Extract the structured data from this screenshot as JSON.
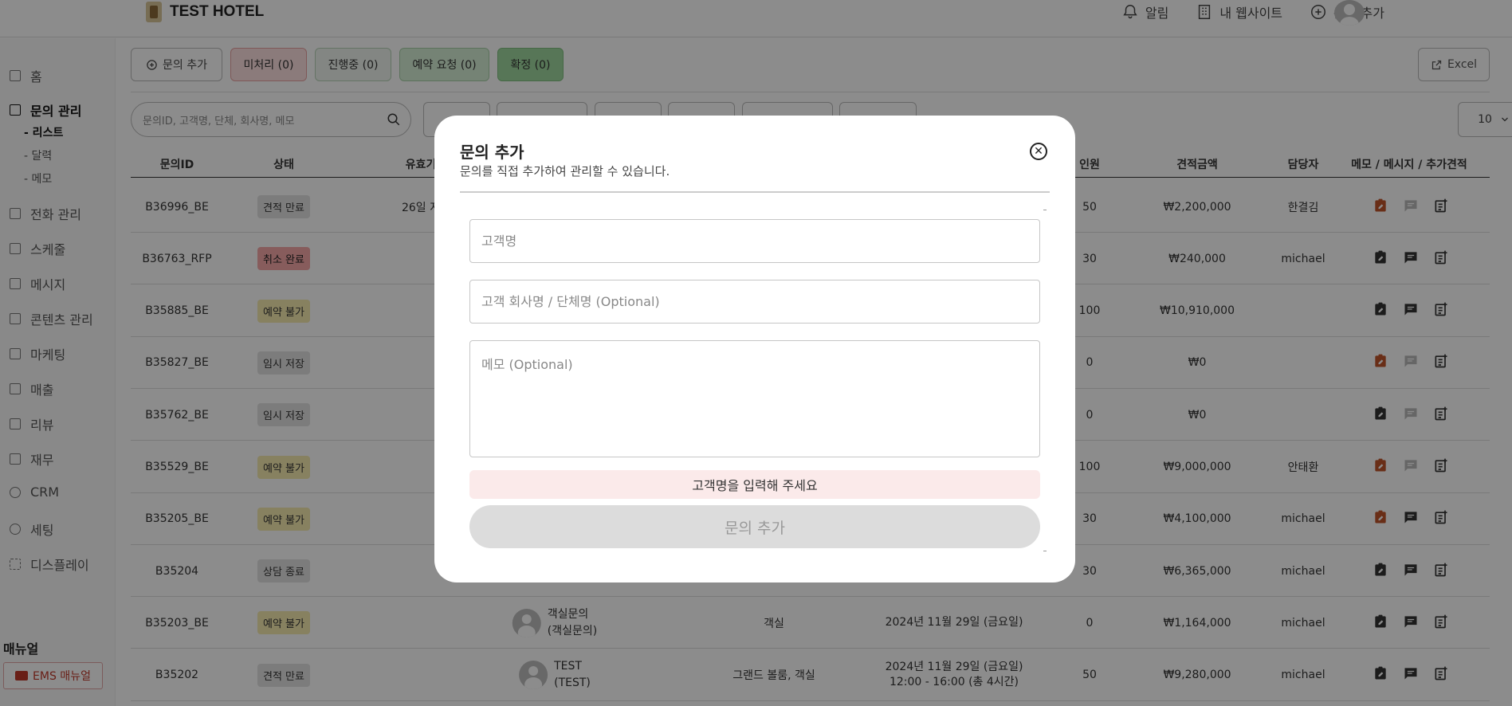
{
  "header": {
    "hotel_name": "TEST HOTEL",
    "actions": [
      {
        "label": "알림",
        "icon": "bell-icon"
      },
      {
        "label": "내 웹사이트",
        "icon": "building-icon"
      },
      {
        "label": "문의 추가",
        "icon": "plus-circle-icon"
      }
    ]
  },
  "sidebar": {
    "items": [
      {
        "label": "홈"
      },
      {
        "label": "문의 관리"
      },
      {
        "label": "전화 관리"
      },
      {
        "label": "스케줄"
      },
      {
        "label": "메시지"
      },
      {
        "label": "콘텐츠 관리"
      },
      {
        "label": "마케팅"
      },
      {
        "label": "매출"
      },
      {
        "label": "리뷰"
      },
      {
        "label": "재무"
      },
      {
        "label": "CRM"
      },
      {
        "label": "세팅"
      },
      {
        "label": "디스플레이"
      }
    ],
    "subitems": [
      "- 리스트",
      "- 달력",
      "- 메모"
    ],
    "manual_title": "매뉴얼",
    "manual_button": "EMS 매뉴얼"
  },
  "toolbar": {
    "add_label": "문의 추가",
    "unprocessed_label": "미처리 (0)",
    "progress_label": "진행중 (0)",
    "request_label": "예약 요청 (0)",
    "confirmed_label": "확정 (0)",
    "excel_label": "Excel",
    "search_placeholder": "문의ID, 고객명, 단체, 회사명, 메모",
    "page_size": "10"
  },
  "table": {
    "headers": [
      "문의ID",
      "상태",
      "유효기",
      "인원",
      "견적금액",
      "담당자",
      "메모 / 메시지 / 추가견적"
    ],
    "rows": [
      {
        "id": "B36996_BE",
        "status": "견적 만료",
        "expiry": "26일 지",
        "people": "50",
        "amount": "₩2,200,000",
        "manager": "한결김"
      },
      {
        "id": "B36763_RFP",
        "status": "취소 완료",
        "expiry": "",
        "people": "30",
        "amount": "₩240,000",
        "manager": "michael"
      },
      {
        "id": "B35885_BE",
        "status": "예약 불가",
        "expiry": "",
        "people": "100",
        "amount": "₩10,910,000",
        "manager": ""
      },
      {
        "id": "B35827_BE",
        "status": "임시 저장",
        "expiry": "",
        "people": "0",
        "amount": "₩0",
        "manager": ""
      },
      {
        "id": "B35762_BE",
        "status": "임시 저장",
        "expiry": "",
        "people": "0",
        "amount": "₩0",
        "manager": ""
      },
      {
        "id": "B35529_BE",
        "status": "예약 불가",
        "expiry": "",
        "people": "100",
        "amount": "₩9,000,000",
        "manager": "안태환"
      },
      {
        "id": "B35205_BE",
        "status": "예약 불가",
        "expiry": "",
        "people": "30",
        "amount": "₩4,100,000",
        "manager": "michael"
      },
      {
        "id": "B35204",
        "status": "상담 종료",
        "expiry": "",
        "people": "30",
        "amount": "₩6,365,000",
        "manager": "michael"
      },
      {
        "id": "B35203_BE",
        "status": "예약 불가",
        "customer_line1": "객실문의",
        "customer_line2": "(객실문의)",
        "type": "객실",
        "date_line1": "2024년 11월 29일 (금요일)",
        "date_line2": "",
        "people": "0",
        "amount": "₩1,164,000",
        "manager": "michael"
      },
      {
        "id": "B35202",
        "status": "견적 만료",
        "customer_line1": "TEST",
        "customer_line2": "(TEST)",
        "type": "그랜드 볼룸, 객실",
        "date_line1": "2024년 11월 29일 (금요일)",
        "date_line2": "12:00 - 16:00 (총 4시간)",
        "people": "50",
        "amount": "₩9,280,000",
        "manager": "michael"
      }
    ]
  },
  "modal": {
    "title": "문의 추가",
    "subtitle": "문의를 직접 추가하여 관리할 수 있습니다.",
    "customer_placeholder": "고객명",
    "company_placeholder": "고객 회사명 / 단체명 (Optional)",
    "memo_placeholder": "메모 (Optional)",
    "alert_text": "고객명을 입력해 주세요",
    "submit_label": "문의 추가"
  },
  "colors": {
    "accent_orange": "#c0552b",
    "status_red": "#f6a8a8",
    "status_yellow": "#f6ebb0",
    "status_gray": "#e2e2e2"
  }
}
